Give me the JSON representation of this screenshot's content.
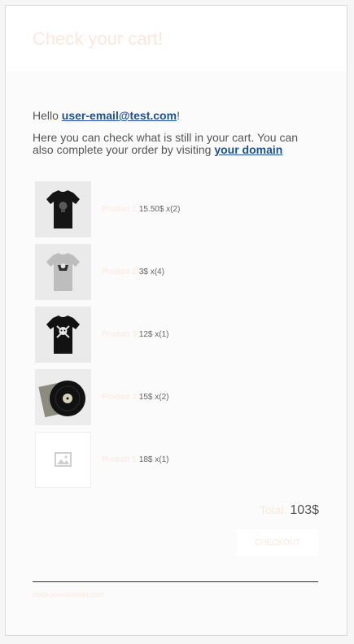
{
  "header": {
    "title": "Check your cart!"
  },
  "greeting": {
    "hello": "Hello",
    "email": "user-email@test.com",
    "punct": "!"
  },
  "intro": {
    "text": "Here you can check what is still in your cart. You can also complete your order by visiting",
    "link": "your domain"
  },
  "products": [
    {
      "name": "Product 1",
      "price_qty": "15.50$ x(2)",
      "image": "black-tshirt-image"
    },
    {
      "name": "Product 2",
      "price_qty": "3$ x(4)",
      "image": "gray-tshirt-image"
    },
    {
      "name": "Product 3",
      "price_qty": "12$ x(1)",
      "image": "black-skull-tshirt-image"
    },
    {
      "name": "Product 4",
      "price_qty": "15$ x(2)",
      "image": "vinyl-record-image"
    },
    {
      "name": "Product 5",
      "price_qty": "18$ x(1)",
      "image": "image-placeholder-icon"
    }
  ],
  "total": {
    "label": "Total:",
    "value": "103$"
  },
  "checkout": {
    "label": "CHECKOUT"
  },
  "footer": {
    "text": "www.yourdomain.com"
  },
  "colors": {
    "accent_light": "#fde7dd",
    "link": "#1c4f9c",
    "card_bg": "#fbfbfb",
    "divider": "#2c2c2c"
  }
}
